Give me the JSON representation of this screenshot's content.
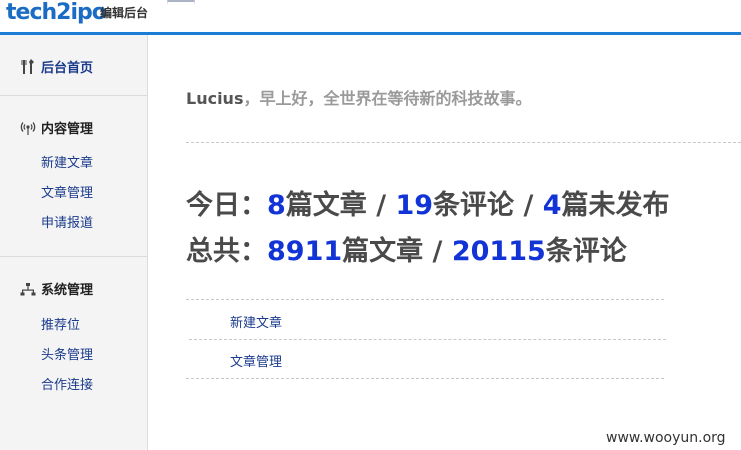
{
  "header": {
    "logo": "tech2ipo",
    "subtitle": "编辑后台"
  },
  "sidebar": {
    "home": {
      "label": "后台首页",
      "icon": "tools-icon"
    },
    "groups": [
      {
        "title": "内容管理",
        "icon": "broadcast-icon",
        "items": [
          "新建文章",
          "文章管理",
          "申请报道"
        ]
      },
      {
        "title": "系统管理",
        "icon": "network-icon",
        "items": [
          "推荐位",
          "头条管理",
          "合作连接"
        ]
      }
    ]
  },
  "main": {
    "greeting": {
      "name": "Lucius",
      "message": "，早上好，全世界在等待新的科技故事。"
    },
    "today": {
      "prefix": "今日：",
      "articles": "8",
      "articles_unit": "篇文章 / ",
      "comments": "19",
      "comments_unit": "条评论 / ",
      "unpublished": "4",
      "unpublished_unit": "篇未发布"
    },
    "total": {
      "prefix": "总共：",
      "articles": "8911",
      "articles_unit": "篇文章 / ",
      "comments": "20115",
      "comments_unit": "条评论"
    },
    "quick_links": [
      "新建文章",
      "文章管理"
    ]
  },
  "watermark": "www.wooyun.org",
  "colors": {
    "accent": "#1a7fd4",
    "link": "#1a3a8c",
    "number": "#1234d6"
  }
}
